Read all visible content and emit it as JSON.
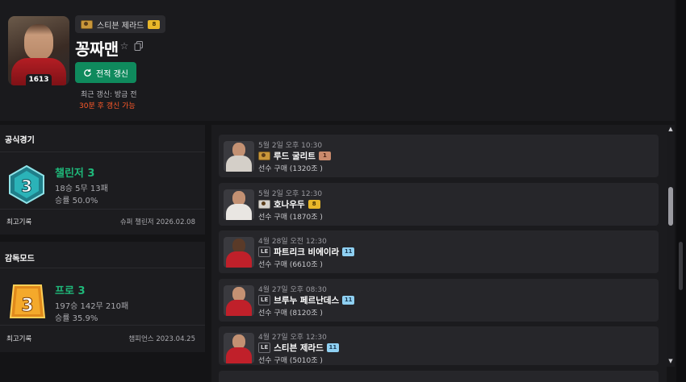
{
  "profile": {
    "player_name": "스티븐 제라드",
    "player_grade": "8",
    "nickname": "꽁짜맨",
    "level": "1613",
    "refresh_label": "전적 갱신",
    "last_refresh": "최근 갱신: 방금 전",
    "next_refresh": "30분 후 갱신 가능"
  },
  "official": {
    "title": "공식경기",
    "rank_name": "챌린저 3",
    "rank_numeral": "3",
    "record": "18승 5무 13패",
    "win_rate": "승률 50.0%",
    "best_label": "최고기록",
    "best_value": "슈퍼 챌린저  2026.02.08"
  },
  "manager": {
    "title": "감독모드",
    "rank_name": "프로 3",
    "rank_numeral": "3",
    "record": "197승 142무 210패",
    "win_rate": "승률 35.9%",
    "best_label": "최고기록",
    "best_value": "챔피언스  2023.04.25"
  },
  "transactions": [
    {
      "date": "5월 2일 오후 10:30",
      "player": "루드 굴리트",
      "season": "icon",
      "grade": "1",
      "grade_style": "copper",
      "price": "선수 구매 (1320조 )",
      "jersey": "#d4cfc8"
    },
    {
      "date": "5월 2일 오후 12:30",
      "player": "호나우두",
      "season": "icon",
      "grade": "8",
      "grade_style": "gold",
      "price": "선수 구매 (1870조 )",
      "jersey": "#e9e6e2"
    },
    {
      "date": "4월 28일 오전 12:30",
      "player": "파트리크 비에이라",
      "season": "LE",
      "grade": "11",
      "grade_style": "silver",
      "price": "선수 구매 (6610조 )",
      "jersey": "#c0202a"
    },
    {
      "date": "4월 27일 오후 08:30",
      "player": "브루누 페르난데스",
      "season": "LE",
      "grade": "11",
      "grade_style": "silver",
      "price": "선수 구매 (8120조 )",
      "jersey": "#c0202a"
    },
    {
      "date": "4월 27일 오후 12:30",
      "player": "스티븐 제라드",
      "season": "LE",
      "grade": "11",
      "grade_style": "silver",
      "price": "선수 구매 (5010조 )",
      "jersey": "#c0202a"
    }
  ],
  "colors": {
    "accent_green": "#0f8a5d",
    "rank_green": "#1fb87a",
    "warning": "#ff5a2a"
  },
  "icons": {
    "star": "star-icon",
    "copy": "copy-icon",
    "refresh": "refresh-icon"
  }
}
